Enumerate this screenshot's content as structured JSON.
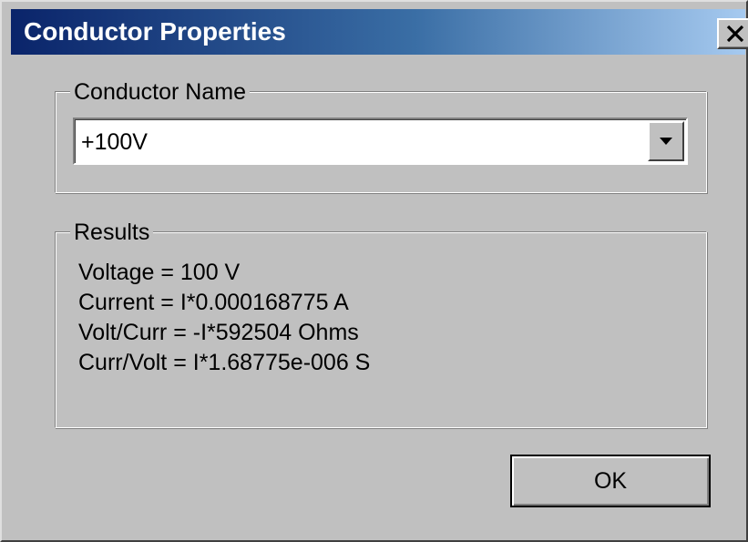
{
  "window": {
    "title": "Conductor Properties",
    "close_label": "close"
  },
  "conductor_name": {
    "legend": "Conductor Name",
    "selected_value": "+100V"
  },
  "results": {
    "legend": "Results",
    "lines": [
      "Voltage = 100 V",
      "Current = I*0.000168775 A",
      "Volt/Curr = -I*592504 Ohms",
      "Curr/Volt = I*1.68775e-006 S"
    ]
  },
  "buttons": {
    "ok_label": "OK"
  },
  "colors": {
    "titlebar_start": "#0a246a",
    "titlebar_end": "#a6caf0",
    "dialog_face": "#c0c0c0"
  },
  "icons": {
    "close": "close-icon",
    "dropdown": "chevron-down-icon"
  }
}
